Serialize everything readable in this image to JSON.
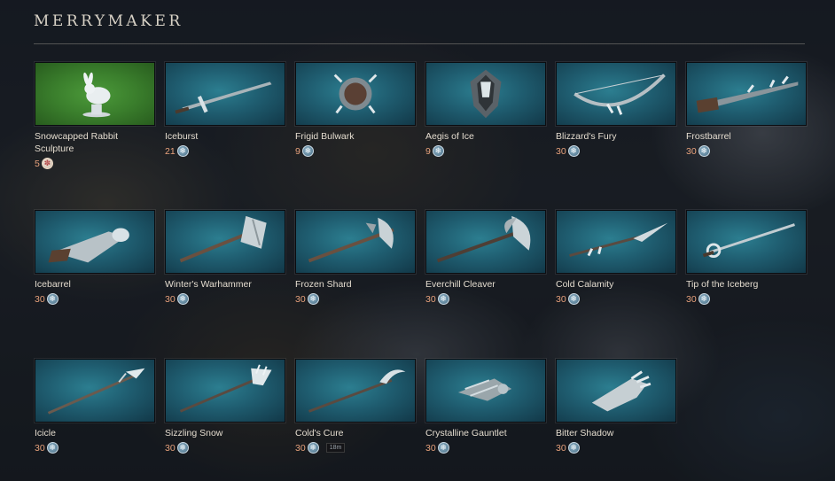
{
  "header": {
    "title": "MERRYMAKER"
  },
  "items": [
    {
      "name": "Snowcapped Rabbit Sculpture",
      "price": "5",
      "currency_icon": "ornament-coin-icon",
      "art": "rabbit-sculpture-icon"
    },
    {
      "name": "Iceburst",
      "price": "21",
      "currency_icon": "snowflake-coin-icon",
      "art": "sword-icon"
    },
    {
      "name": "Frigid Bulwark",
      "price": "9",
      "currency_icon": "snowflake-coin-icon",
      "art": "round-shield-icon"
    },
    {
      "name": "Aegis of Ice",
      "price": "9",
      "currency_icon": "snowflake-coin-icon",
      "art": "kite-shield-icon"
    },
    {
      "name": "Blizzard's Fury",
      "price": "30",
      "currency_icon": "snowflake-coin-icon",
      "art": "bow-icon"
    },
    {
      "name": "Frostbarrel",
      "price": "30",
      "currency_icon": "snowflake-coin-icon",
      "art": "musket-icon"
    },
    {
      "name": "Icebarrel",
      "price": "30",
      "currency_icon": "snowflake-coin-icon",
      "art": "blunderbuss-icon"
    },
    {
      "name": "Winter's Warhammer",
      "price": "30",
      "currency_icon": "snowflake-coin-icon",
      "art": "warhammer-icon"
    },
    {
      "name": "Frozen Shard",
      "price": "30",
      "currency_icon": "snowflake-coin-icon",
      "art": "axe-icon"
    },
    {
      "name": "Everchill Cleaver",
      "price": "30",
      "currency_icon": "snowflake-coin-icon",
      "art": "great-axe-icon"
    },
    {
      "name": "Cold Calamity",
      "price": "30",
      "currency_icon": "snowflake-coin-icon",
      "art": "spear-icon"
    },
    {
      "name": "Tip of the Iceberg",
      "price": "30",
      "currency_icon": "snowflake-coin-icon",
      "art": "rapier-icon"
    },
    {
      "name": "Icicle",
      "price": "30",
      "currency_icon": "snowflake-coin-icon",
      "art": "staff-icon"
    },
    {
      "name": "Sizzling Snow",
      "price": "30",
      "currency_icon": "snowflake-coin-icon",
      "art": "fire-staff-icon"
    },
    {
      "name": "Cold's Cure",
      "price": "30",
      "currency_icon": "snowflake-coin-icon",
      "art": "life-staff-icon",
      "tooltip": "18m"
    },
    {
      "name": "Crystalline Gauntlet",
      "price": "30",
      "currency_icon": "snowflake-coin-icon",
      "art": "ice-gauntlet-icon"
    },
    {
      "name": "Bitter Shadow",
      "price": "30",
      "currency_icon": "snowflake-coin-icon",
      "art": "void-gauntlet-icon"
    }
  ],
  "colors": {
    "thumb_teal": "#1f5d70",
    "thumb_green": "#3a7e2c",
    "price": "#e8a27c",
    "title": "#d8d2c6"
  }
}
